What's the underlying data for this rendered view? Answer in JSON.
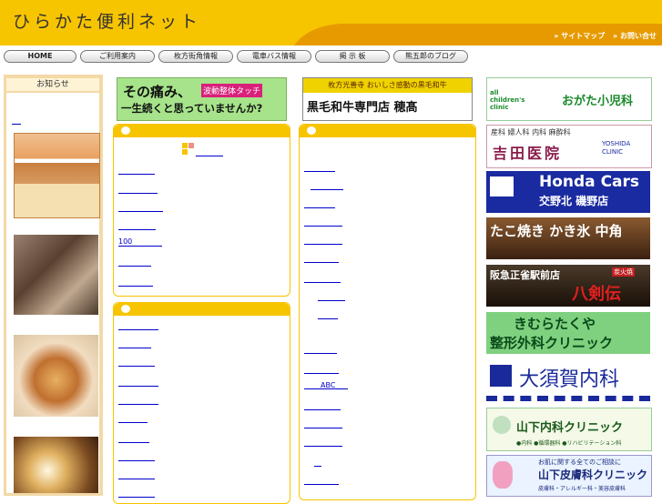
{
  "header": {
    "site_title": "ひらかた便利ネット",
    "sitemap_label": "» サイトマップ",
    "contact_label": "» お問い合せ"
  },
  "menu": [
    {
      "label": "HOME"
    },
    {
      "label": "ご利用案内"
    },
    {
      "label": "枚方街角情報"
    },
    {
      "label": "電車バス情報"
    },
    {
      "label": "掲 示 板"
    },
    {
      "label": "熊五郎のブログ"
    }
  ],
  "left": {
    "news_title": "お知らせ"
  },
  "banners": {
    "left_banner_line1": "その痛み、",
    "left_banner_box": "波動整体タッチ",
    "left_banner_line2": "一生続くと思っていませんか?",
    "right_banner_top": "枚方光善寺 おいしさ感動の黒毛和牛",
    "right_banner_bottom": "黒毛和牛専門店 穂髙"
  },
  "center_links_top": [
    "100"
  ],
  "right_links": [
    "ABC"
  ],
  "ads": [
    {
      "text": "おがた小児科",
      "sub": "all children's clinic",
      "bg": "#ffffff",
      "fg": "#1a8a2a"
    },
    {
      "text": "吉田医院",
      "sub": "産科 婦人科 内科 麻酔科",
      "extra": "YOSHIDA CLINIC",
      "bg": "#ffffff",
      "fg": "#8a1a4a"
    },
    {
      "text": "Honda Cars",
      "sub": "交野北 磯野店",
      "bg": "#1a2aa0",
      "fg": "#ffffff"
    },
    {
      "text": "たこ焼き かき氷 中角",
      "bg": "#5a3a20",
      "fg": "#ffffff"
    },
    {
      "text": "阪急正雀駅前店",
      "sub": "八剣伝",
      "extra": "炭火焼",
      "bg": "#3a2a1a",
      "fg": "#ffffff"
    },
    {
      "text": "きむらたくや",
      "sub": "整形外科クリニック",
      "bg": "#7fd17f",
      "fg": "#0a4a1a"
    },
    {
      "text": "大須賀内科",
      "bg": "#ffffff",
      "fg": "#1a2a9a"
    },
    {
      "text": "山下内科クリニック",
      "sub": "●内科 ●循環器科 ●リハビリテーション科",
      "bg": "#f4f9e8",
      "fg": "#1a5a1a"
    },
    {
      "text": "山下皮膚科クリニック",
      "sub": "皮膚科・アレルギー科・美容皮膚科",
      "extra": "お肌に関する全てのご相談に",
      "bg": "#eaf3ff",
      "fg": "#1a2a7a"
    }
  ]
}
